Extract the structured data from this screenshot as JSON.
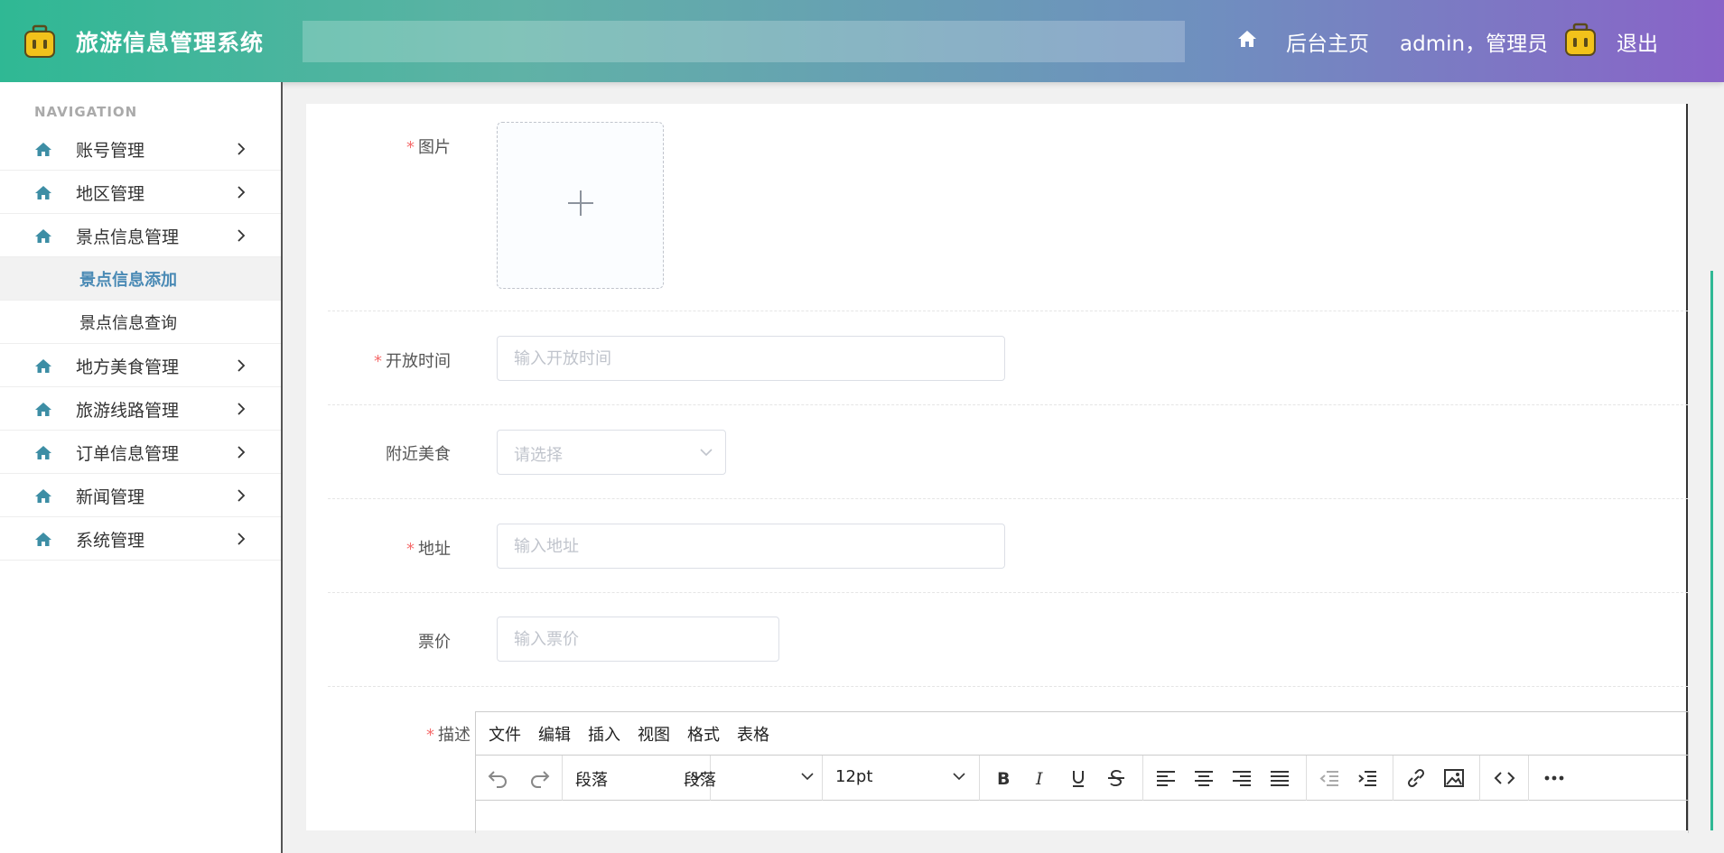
{
  "header": {
    "app_title": "旅游信息管理系统",
    "home_label": "后台主页",
    "user_label": "admin，管理员",
    "logout_label": "退出",
    "brand_colors": [
      "#2fb894",
      "#8963c8"
    ]
  },
  "sidebar": {
    "heading": "NAVIGATION",
    "items": [
      {
        "label": "账号管理",
        "icon": "home-icon"
      },
      {
        "label": "地区管理",
        "icon": "home-icon"
      },
      {
        "label": "景点信息管理",
        "icon": "home-icon",
        "expanded": true,
        "children": [
          {
            "label": "景点信息添加",
            "active": true
          },
          {
            "label": "景点信息查询",
            "active": false
          }
        ]
      },
      {
        "label": "地方美食管理",
        "icon": "home-icon"
      },
      {
        "label": "旅游线路管理",
        "icon": "home-icon"
      },
      {
        "label": "订单信息管理",
        "icon": "home-icon"
      },
      {
        "label": "新闻管理",
        "icon": "home-icon"
      },
      {
        "label": "系统管理",
        "icon": "home-icon"
      }
    ]
  },
  "form": {
    "image": {
      "label": "图片",
      "required": true
    },
    "open_time": {
      "label": "开放时间",
      "required": true,
      "placeholder": "输入开放时间"
    },
    "nearby_food": {
      "label": "附近美食",
      "required": false,
      "placeholder": "请选择"
    },
    "address": {
      "label": "地址",
      "required": true,
      "placeholder": "输入地址"
    },
    "price": {
      "label": "票价",
      "required": false,
      "placeholder": "输入票价"
    },
    "description": {
      "label": "描述",
      "required": true
    }
  },
  "editor": {
    "menus": [
      "文件",
      "编辑",
      "插入",
      "视图",
      "格式",
      "表格"
    ],
    "block_format_1": "段落",
    "block_format_2": "段落",
    "font_size": "12pt"
  }
}
